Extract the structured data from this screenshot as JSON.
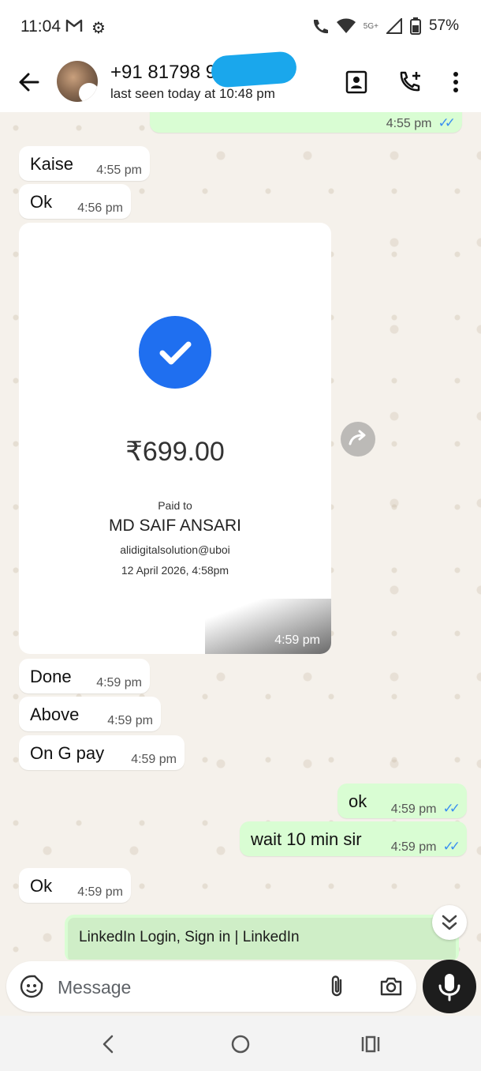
{
  "status_bar": {
    "time": "11:04",
    "network": "5G+",
    "battery": "57%",
    "icons": [
      "gmail-icon",
      "settings-icon",
      "wifi-call-icon",
      "wifi-icon",
      "signal-icon",
      "battery-icon"
    ]
  },
  "header": {
    "contact_name": "+91 81798 9",
    "last_seen": "last seen today at 10:48 pm",
    "icons": [
      "back-arrow-icon",
      "contact-card-icon",
      "add-call-icon",
      "more-vert-icon"
    ]
  },
  "messages": [
    {
      "dir": "out",
      "text": "",
      "time": "4:55 pm",
      "read": true
    },
    {
      "dir": "in",
      "text": "Kaise",
      "time": "4:55 pm"
    },
    {
      "dir": "in",
      "text": "Ok",
      "time": "4:56 pm"
    },
    {
      "dir": "in",
      "type": "image",
      "time": "4:59 pm"
    },
    {
      "dir": "in",
      "text": "Done",
      "time": "4:59 pm"
    },
    {
      "dir": "in",
      "text": "Above",
      "time": "4:59 pm"
    },
    {
      "dir": "in",
      "text": "On G pay",
      "time": "4:59 pm"
    },
    {
      "dir": "out",
      "text": "ok",
      "time": "4:59 pm",
      "read": true
    },
    {
      "dir": "out",
      "text": "wait 10 min sir",
      "time": "4:59 pm",
      "read": true
    },
    {
      "dir": "in",
      "text": "Ok",
      "time": "4:59 pm"
    }
  ],
  "payment_receipt": {
    "amount": "₹699.00",
    "paid_to_label": "Paid to",
    "payee": "MD SAIF ANSARI",
    "upi_id": "alidigitalsolution@uboi",
    "date": "12 April 2026, 4:58pm"
  },
  "link_preview": {
    "title": "LinkedIn Login, Sign in | LinkedIn"
  },
  "composer": {
    "placeholder": "Message"
  },
  "colors": {
    "incoming_bubble": "#ffffff",
    "outgoing_bubble": "#d9fdd3",
    "read_ticks": "#3b8ff0",
    "payment_check": "#1f6ff0",
    "chat_background": "#f5f1eb",
    "redaction": "#1aa7ec"
  }
}
